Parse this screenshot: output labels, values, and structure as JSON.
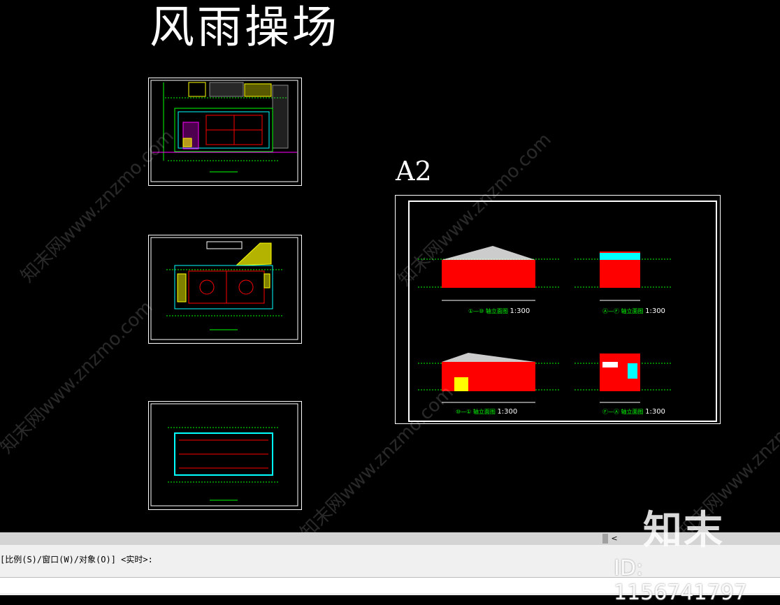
{
  "drawing": {
    "title": "风雨操场",
    "sheet_label": "A2",
    "elevations": [
      {
        "name": "①—⑩ 轴立面图",
        "scale": "1:300"
      },
      {
        "name": "Ⓐ—Ⓕ 轴立面图",
        "scale": "1:300"
      },
      {
        "name": "⑩—① 轴立面图",
        "scale": "1:300"
      },
      {
        "name": "Ⓕ—Ⓐ 轴立面图",
        "scale": "1:300"
      }
    ]
  },
  "command": {
    "prompt": "[比例(S)/窗口(W)/对象(O)] <实时>:"
  },
  "scrollbar": {
    "left_arrow": "<"
  },
  "watermark": {
    "text": "知末网www.znzmo.com",
    "logo": "知末",
    "id": "ID: 1156741797"
  },
  "colors": {
    "background": "#000000",
    "line": "#ffffff",
    "red": "#ff0000",
    "green": "#00ff00",
    "cyan": "#00ffff",
    "yellow": "#ffff00",
    "magenta": "#ff00ff"
  }
}
